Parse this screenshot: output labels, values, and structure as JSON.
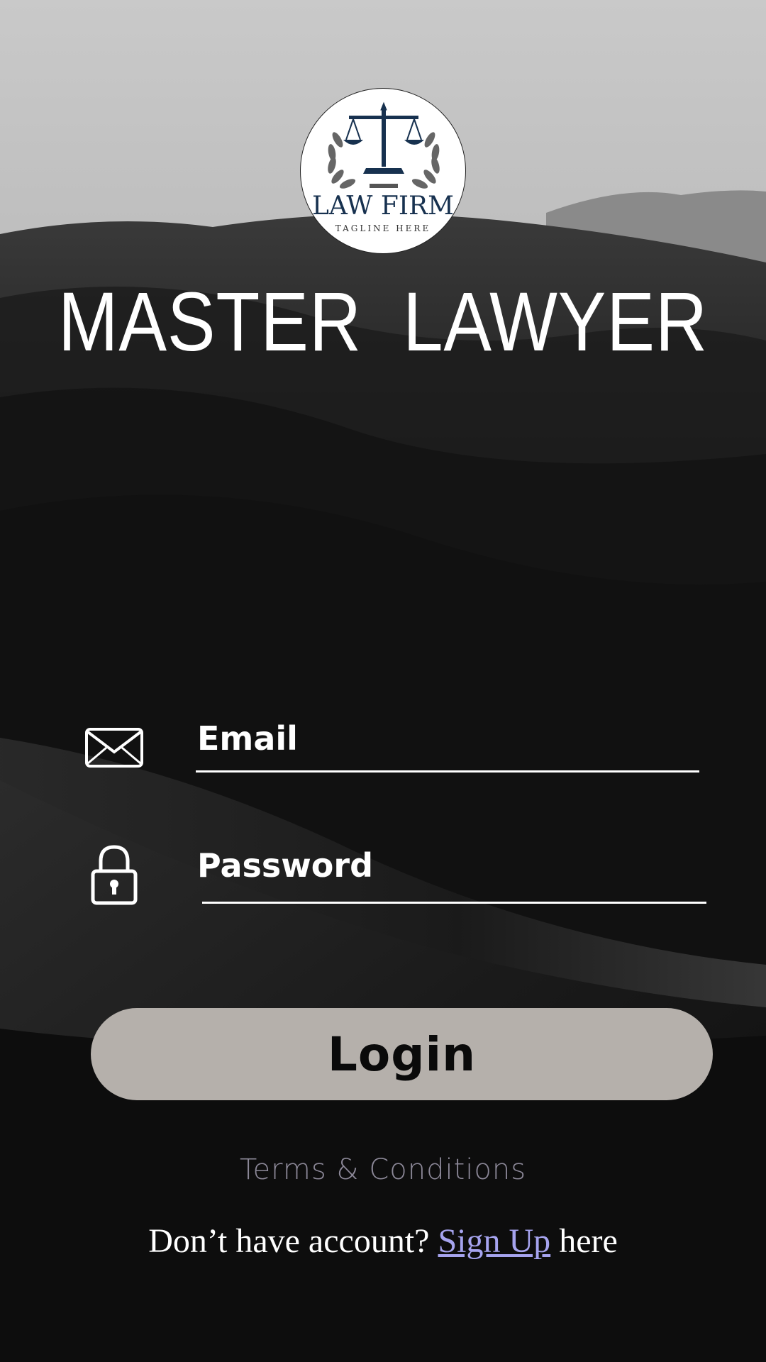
{
  "logo": {
    "name": "LAW FIRM",
    "tagline": "TAGLINE HERE"
  },
  "app_title": "MASTER  LAWYER",
  "form": {
    "email_label": "Email",
    "password_label": "Password",
    "email_icon": "envelope-icon",
    "password_icon": "lock-icon"
  },
  "login_button": {
    "label": "Login"
  },
  "terms_link": "Terms & Conditions",
  "signup": {
    "prefix": "Don’t have account? ",
    "link": "Sign Up",
    "suffix": " here"
  },
  "colors": {
    "logo_navy": "#17314f",
    "button_bg": "#b5b0ab",
    "link": "#a6a4ef",
    "terms": "#b7b2c7"
  }
}
